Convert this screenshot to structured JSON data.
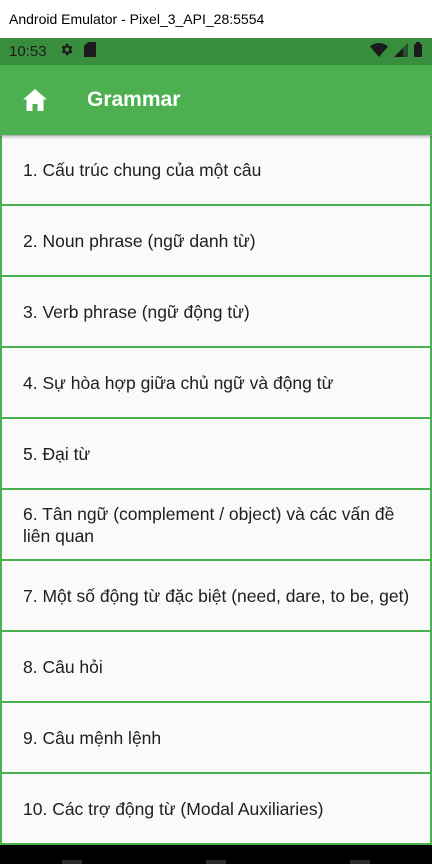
{
  "window": {
    "title": "Android Emulator - Pixel_3_API_28:5554"
  },
  "status_bar": {
    "time": "10:53",
    "icons": [
      "gear-icon",
      "sd-card-icon",
      "wifi-icon",
      "signal-icon",
      "battery-icon"
    ]
  },
  "app_bar": {
    "title": "Grammar",
    "home_icon": "home-icon",
    "color": "#4caf50"
  },
  "colors": {
    "primary": "#4caf50",
    "primary_dark": "#388e3c",
    "divider": "#4caf50"
  },
  "items": [
    {
      "label": "1. Cấu trúc chung của một câu"
    },
    {
      "label": "2. Noun phrase (ngữ danh từ)"
    },
    {
      "label": "3. Verb phrase (ngữ động từ)"
    },
    {
      "label": "4. Sự hòa hợp giữa chủ ngữ và động từ"
    },
    {
      "label": "5. Đại từ"
    },
    {
      "label": "6. Tân ngữ (complement / object) và các vấn đề liên quan"
    },
    {
      "label": "7. Một số động từ đặc biệt (need, dare, to be, get)"
    },
    {
      "label": "8. Câu hỏi"
    },
    {
      "label": "9. Câu mệnh lệnh"
    },
    {
      "label": "10. Các trợ động từ (Modal Auxiliaries)"
    }
  ]
}
